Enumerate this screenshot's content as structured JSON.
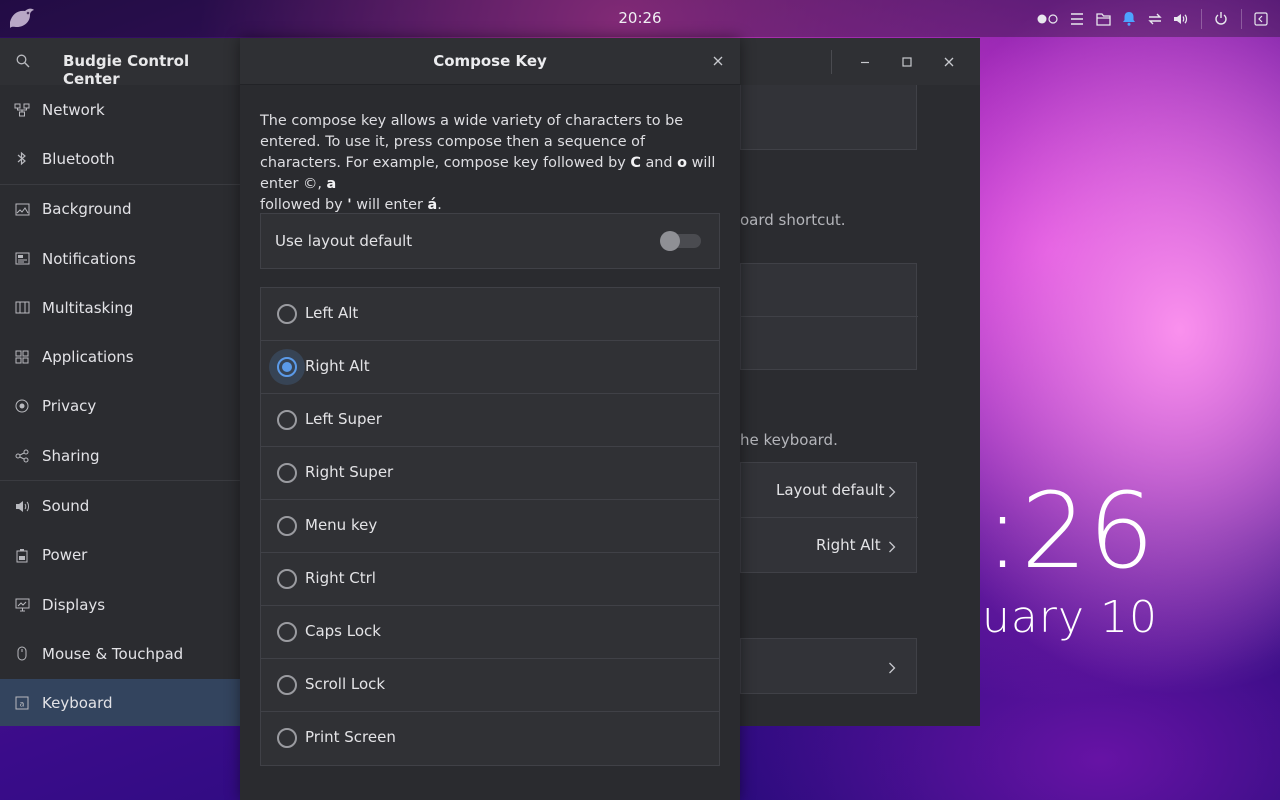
{
  "top_panel": {
    "clock": "20:26",
    "tray_icons": [
      "workspace-icon",
      "menu-icon",
      "files-icon",
      "bell-icon",
      "network-icon",
      "volume-icon",
      "power-icon",
      "panel-icon"
    ]
  },
  "desktop_widget": {
    "time_fragment": ":26",
    "date_fragment": "uary 10"
  },
  "settings_window": {
    "title": "Budgie Control Center",
    "sidebar": {
      "items": [
        {
          "label": "Network",
          "icon": "network-icon"
        },
        {
          "label": "Bluetooth",
          "icon": "bluetooth-icon"
        },
        {
          "label": "Background",
          "icon": "background-icon"
        },
        {
          "label": "Notifications",
          "icon": "notifications-icon"
        },
        {
          "label": "Multitasking",
          "icon": "multitasking-icon"
        },
        {
          "label": "Applications",
          "icon": "applications-icon"
        },
        {
          "label": "Privacy",
          "icon": "privacy-icon"
        },
        {
          "label": "Sharing",
          "icon": "sharing-icon"
        },
        {
          "label": "Sound",
          "icon": "sound-icon"
        },
        {
          "label": "Power",
          "icon": "power-icon"
        },
        {
          "label": "Displays",
          "icon": "displays-icon"
        },
        {
          "label": "Mouse & Touchpad",
          "icon": "mouse-icon"
        },
        {
          "label": "Keyboard",
          "icon": "keyboard-icon",
          "active": true
        }
      ]
    },
    "background_fragments": {
      "shortcut_hint": "oard shortcut.",
      "keyboard_hint": "he keyboard.",
      "alternate_chars_value": "Layout default",
      "compose_key_value": "Right Alt"
    }
  },
  "compose_dialog": {
    "title": "Compose Key",
    "description_parts": {
      "p1": "The compose key allows a wide variety of characters to be entered. To use it, press compose then a sequence of characters.  For example, compose key followed by ",
      "k1": "C",
      "p2": " and ",
      "k2": "o",
      "p3": " will enter ©, ",
      "k3": "a",
      "p4": " followed by ",
      "k4": "'",
      "p5": " will enter ",
      "k5": "á",
      "p6": "."
    },
    "use_layout_default": {
      "label": "Use layout default",
      "enabled": false
    },
    "options": [
      {
        "label": "Left Alt",
        "selected": false
      },
      {
        "label": "Right Alt",
        "selected": true
      },
      {
        "label": "Left Super",
        "selected": false
      },
      {
        "label": "Right Super",
        "selected": false
      },
      {
        "label": "Menu key",
        "selected": false
      },
      {
        "label": "Right Ctrl",
        "selected": false
      },
      {
        "label": "Caps Lock",
        "selected": false
      },
      {
        "label": "Scroll Lock",
        "selected": false
      },
      {
        "label": "Print Screen",
        "selected": false
      }
    ],
    "accent_color": "#5b9ae8"
  }
}
